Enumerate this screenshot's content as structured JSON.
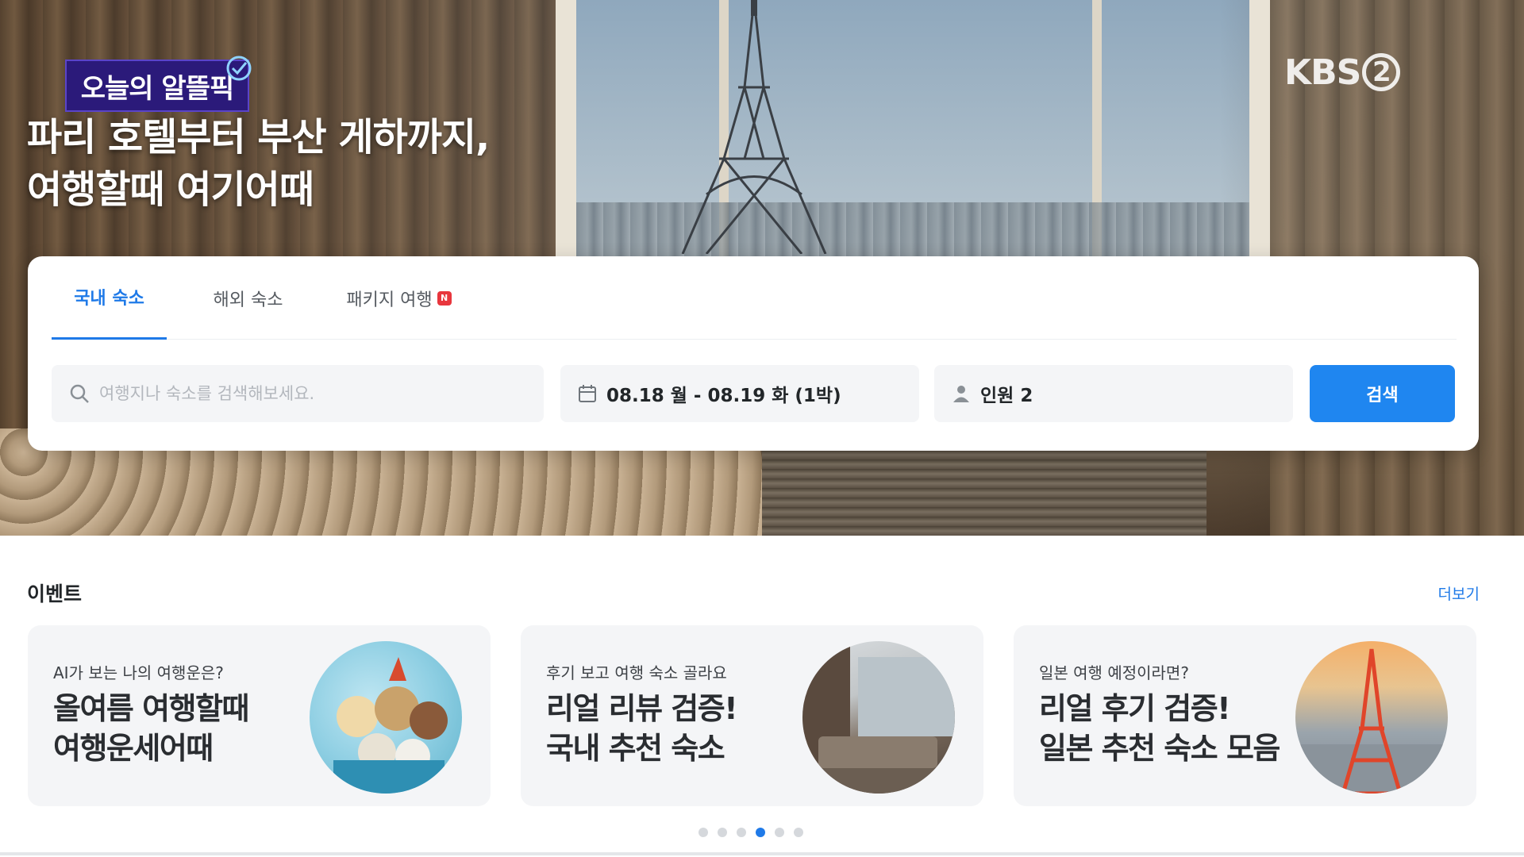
{
  "hero": {
    "badge": "오늘의 알뜰픽",
    "headline_line1": "파리 호텔부터 부산 게하까지,",
    "headline_line2": "여행할때 여기어때",
    "broadcaster_logo": "KBS",
    "broadcaster_channel": "2"
  },
  "search": {
    "tabs": [
      {
        "label": "국내 숙소",
        "active": true
      },
      {
        "label": "해외 숙소",
        "active": false
      },
      {
        "label": "패키지 여행",
        "active": false,
        "badge": "N"
      }
    ],
    "query_placeholder": "여행지나 숙소를 검색해보세요.",
    "dates": "08.18 월 - 08.19 화 (1박)",
    "guests": "인원 2",
    "submit_label": "검색"
  },
  "events": {
    "title": "이벤트",
    "more_label": "더보기",
    "cards": [
      {
        "subtitle": "AI가 보는 나의 여행운은?",
        "title_line1": "올여름 여행할때",
        "title_line2": "여행운세어때",
        "image_icon": "animal-travelers-illustration"
      },
      {
        "subtitle": "후기 보고 여행 숙소 골라요",
        "title_line1": "리얼 리뷰 검증!",
        "title_line2": "국내 추천 숙소",
        "image_icon": "hotel-room-photo"
      },
      {
        "subtitle": "일본 여행 예정이라면?",
        "title_line1": "리얼 후기 검증!",
        "title_line2": "일본 추천 숙소 모음",
        "image_icon": "tokyo-tower-photo"
      }
    ],
    "pagination": {
      "total": 6,
      "active_index": 3
    }
  },
  "colors": {
    "accent": "#1f7ae8",
    "button": "#1f86f0",
    "badge_bg": "#2b1a7a",
    "new_badge": "#e8363d"
  }
}
